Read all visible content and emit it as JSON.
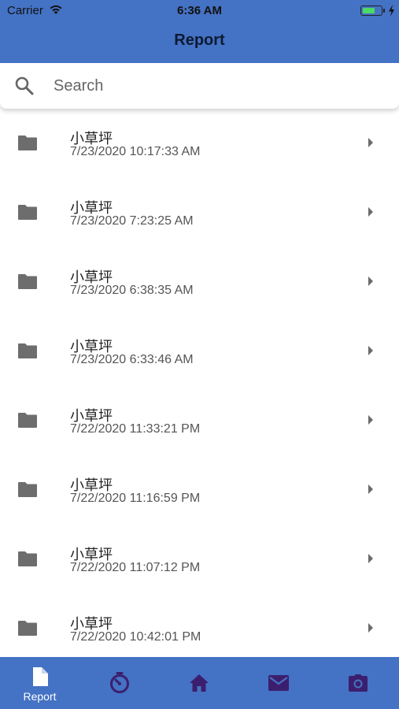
{
  "status_bar": {
    "carrier": "Carrier",
    "time": "6:36 AM",
    "battery_level": 0.7
  },
  "header": {
    "title": "Report"
  },
  "search": {
    "placeholder": "Search",
    "value": ""
  },
  "reports": [
    {
      "title": "小草坪",
      "timestamp": "7/23/2020 10:17:33 AM"
    },
    {
      "title": "小草坪",
      "timestamp": "7/23/2020 7:23:25 AM"
    },
    {
      "title": "小草坪",
      "timestamp": "7/23/2020 6:38:35 AM"
    },
    {
      "title": "小草坪",
      "timestamp": "7/23/2020 6:33:46 AM"
    },
    {
      "title": "小草坪",
      "timestamp": "7/22/2020 11:33:21 PM"
    },
    {
      "title": "小草坪",
      "timestamp": "7/22/2020 11:16:59 PM"
    },
    {
      "title": "小草坪",
      "timestamp": "7/22/2020 11:07:12 PM"
    },
    {
      "title": "小草坪",
      "timestamp": "7/22/2020 10:42:01 PM"
    }
  ],
  "tabbar": {
    "tabs": [
      {
        "icon": "document-icon",
        "label": "Report",
        "active": true
      },
      {
        "icon": "timer-icon",
        "label": "",
        "active": false
      },
      {
        "icon": "home-icon",
        "label": "",
        "active": false
      },
      {
        "icon": "mail-icon",
        "label": "",
        "active": false
      },
      {
        "icon": "camera-icon",
        "label": "",
        "active": false
      }
    ]
  },
  "colors": {
    "primary": "#4472c4",
    "inactive_icon": "#3b1f6e",
    "active_icon": "#ffffff",
    "folder": "#6d6d6d"
  }
}
